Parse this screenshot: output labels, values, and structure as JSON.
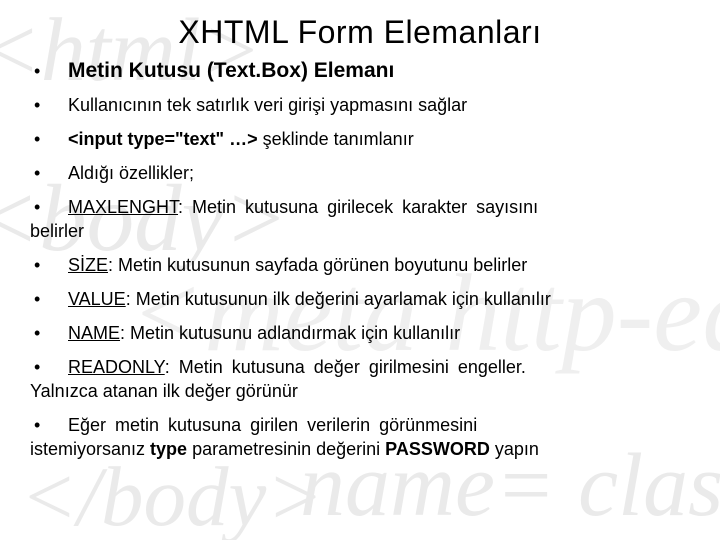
{
  "title": "XHTML Form Elemanları",
  "items": [
    {
      "bullet": "•",
      "segs": [
        {
          "t": "Metin Kutusu (Text.Box) Elemanı",
          "b": true
        }
      ],
      "lead": true
    },
    {
      "bullet": "•",
      "segs": [
        {
          "t": "Kullanıcının tek satırlık veri girişi yapmasını sağlar"
        }
      ]
    },
    {
      "bullet": "•",
      "segs": [
        {
          "t": "<input type=\"text\" …>",
          "b": true
        },
        {
          "t": " şeklinde tanımlanır"
        }
      ]
    },
    {
      "bullet": "•",
      "segs": [
        {
          "t": "Aldığı özellikler;"
        }
      ]
    },
    {
      "bullet": "•",
      "just": "wide",
      "segs": [
        {
          "t": "MAXLENGHT",
          "ul": true
        },
        {
          "t": ": Metin kutusuna girilecek karakter sayısını"
        }
      ],
      "cont": "belirler"
    },
    {
      "bullet": "•",
      "segs": [
        {
          "t": "SİZE",
          "ul": true
        },
        {
          "t": ": Metin kutusunun sayfada görünen boyutunu belirler"
        }
      ]
    },
    {
      "bullet": "•",
      "segs": [
        {
          "t": "VALUE",
          "ul": true
        },
        {
          "t": ": Metin kutusunun ilk değerini ayarlamak için kullanılır"
        }
      ]
    },
    {
      "bullet": "•",
      "segs": [
        {
          "t": "NAME",
          "ul": true
        },
        {
          "t": ": Metin kutusunu adlandırmak için kullanılır"
        }
      ]
    },
    {
      "bullet": "•",
      "just": "wide",
      "segs": [
        {
          "t": "READONLY",
          "ul": true
        },
        {
          "t": ": Metin kutusuna değer girilmesini engeller."
        }
      ],
      "cont": "Yalnızca atanan ilk değer görünür"
    },
    {
      "bullet": "•",
      "just": "wide",
      "segs": [
        {
          "t": "Eğer metin kutusuna girilen verilerin görünmesini"
        }
      ],
      "cont_segs": [
        {
          "t": "istemiyorsanız "
        },
        {
          "t": "type",
          "b": true
        },
        {
          "t": " parametresinin değerini "
        },
        {
          "t": "PASSWORD",
          "b": true
        },
        {
          "t": " yapın"
        }
      ]
    }
  ]
}
